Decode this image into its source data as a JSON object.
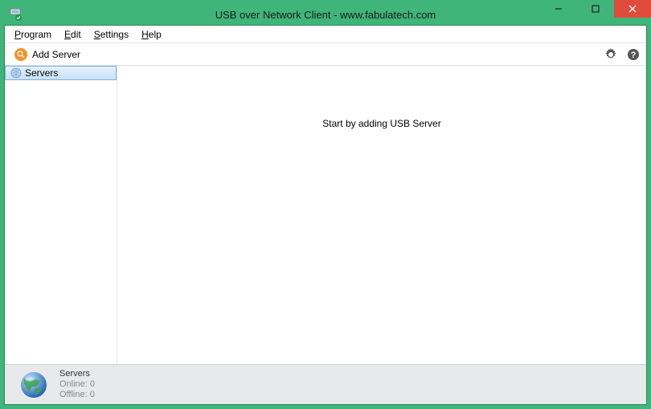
{
  "window": {
    "title": "USB over Network Client - www.fabulatech.com"
  },
  "menubar": {
    "program": "Program",
    "edit": "Edit",
    "settings": "Settings",
    "help": "Help"
  },
  "toolbar": {
    "add_server": "Add Server"
  },
  "sidebar": {
    "servers_label": "Servers"
  },
  "main": {
    "empty_message": "Start by adding USB Server"
  },
  "status": {
    "heading": "Servers",
    "online": "Online: 0",
    "offline": "Offline: 0"
  }
}
